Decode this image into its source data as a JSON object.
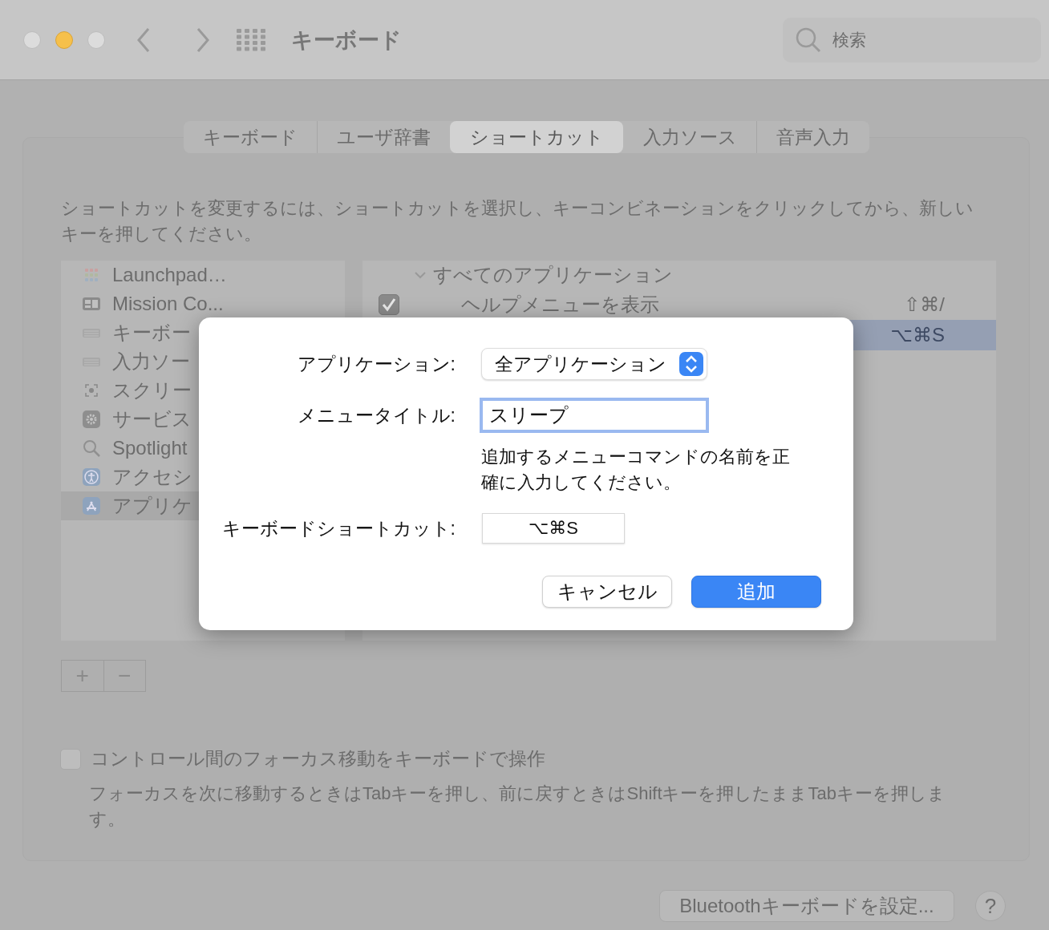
{
  "window": {
    "title": "キーボード",
    "search": {
      "placeholder": "検索"
    }
  },
  "tabs": [
    {
      "label": "キーボード",
      "selected": false
    },
    {
      "label": "ユーザ辞書",
      "selected": false
    },
    {
      "label": "ショートカット",
      "selected": true
    },
    {
      "label": "入力ソース",
      "selected": false
    },
    {
      "label": "音声入力",
      "selected": false
    }
  ],
  "description": "ショートカットを変更するには、ショートカットを選択し、キーコンビネーションをクリックしてから、新しいキーを押してください。",
  "categories": [
    {
      "label": "Launchpad…",
      "selected": false
    },
    {
      "label": "Mission Co...",
      "selected": false
    },
    {
      "label": "キーボー",
      "selected": false
    },
    {
      "label": "入力ソー",
      "selected": false
    },
    {
      "label": "スクリー",
      "selected": false
    },
    {
      "label": "サービス",
      "selected": false
    },
    {
      "label": "Spotlight",
      "selected": false
    },
    {
      "label": "アクセシ",
      "selected": false
    },
    {
      "label": "アプリケ",
      "selected": true
    }
  ],
  "shortcuts": {
    "group": {
      "label": "すべてのアプリケーション",
      "expanded": true
    },
    "rows": [
      {
        "label": "ヘルプメニューを表示",
        "checked": true,
        "shortcut": "⇧⌘/",
        "selected": false
      },
      {
        "shortcut": "⌥⌘S",
        "selected": true
      }
    ],
    "add_button": "+",
    "remove_button": "−"
  },
  "focus_option": {
    "label": "コントロール間のフォーカス移動をキーボードで操作",
    "checked": false,
    "note": "フォーカスを次に移動するときはTabキーを押し、前に戻すときはShiftキーを押したままTabキーを押します。"
  },
  "bluetooth_button": "Bluetoothキーボードを設定...",
  "help_button": "?",
  "dialog": {
    "application_label": "アプリケーション:",
    "application": "全アプリケーション",
    "menu_title_label": "メニュータイトル:",
    "menu_title": "スリープ",
    "hint": "追加するメニューコマンドの名前を正確に入力してください。",
    "shortcut_label": "キーボードショートカット:",
    "shortcut": "⌥⌘S",
    "buttons": [
      {
        "label": "キャンセル",
        "kind": "secondary"
      },
      {
        "label": "追加",
        "kind": "primary"
      }
    ]
  }
}
